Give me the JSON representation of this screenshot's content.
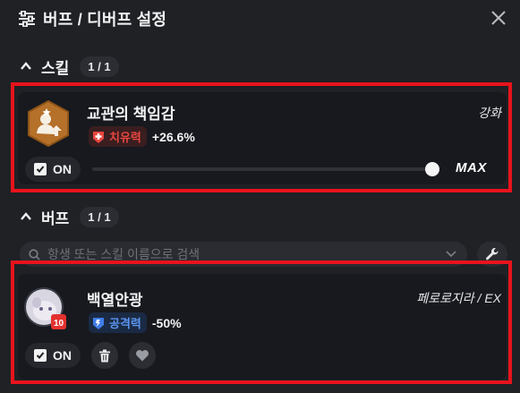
{
  "header": {
    "title": "버프 / 디버프 설정",
    "settings_icon": "sliders-icon",
    "close_icon": "close-icon"
  },
  "skill_section": {
    "label": "스킬",
    "count": "1 / 1",
    "card": {
      "name": "교관의 책임감",
      "tag": "강화",
      "stat_label": "치유력",
      "stat_value": "+26.6%",
      "stat_color": "#e8463f",
      "toggle_label": "ON",
      "slider_level_fraction": 1.0,
      "max_label": "MAX"
    }
  },
  "buff_section": {
    "label": "버프",
    "count": "1 / 1",
    "search_placeholder": "항생 또는 스킬 이름으로 검색",
    "card": {
      "name": "백열안광",
      "tag": "페로로지라 / EX",
      "stat_label": "공격력",
      "stat_value": "-50%",
      "stat_color": "#3f7de8",
      "toggle_label": "ON"
    }
  },
  "colors": {
    "accent_red": "#e8131c",
    "background": "#1f2125",
    "card": "#17191e"
  }
}
